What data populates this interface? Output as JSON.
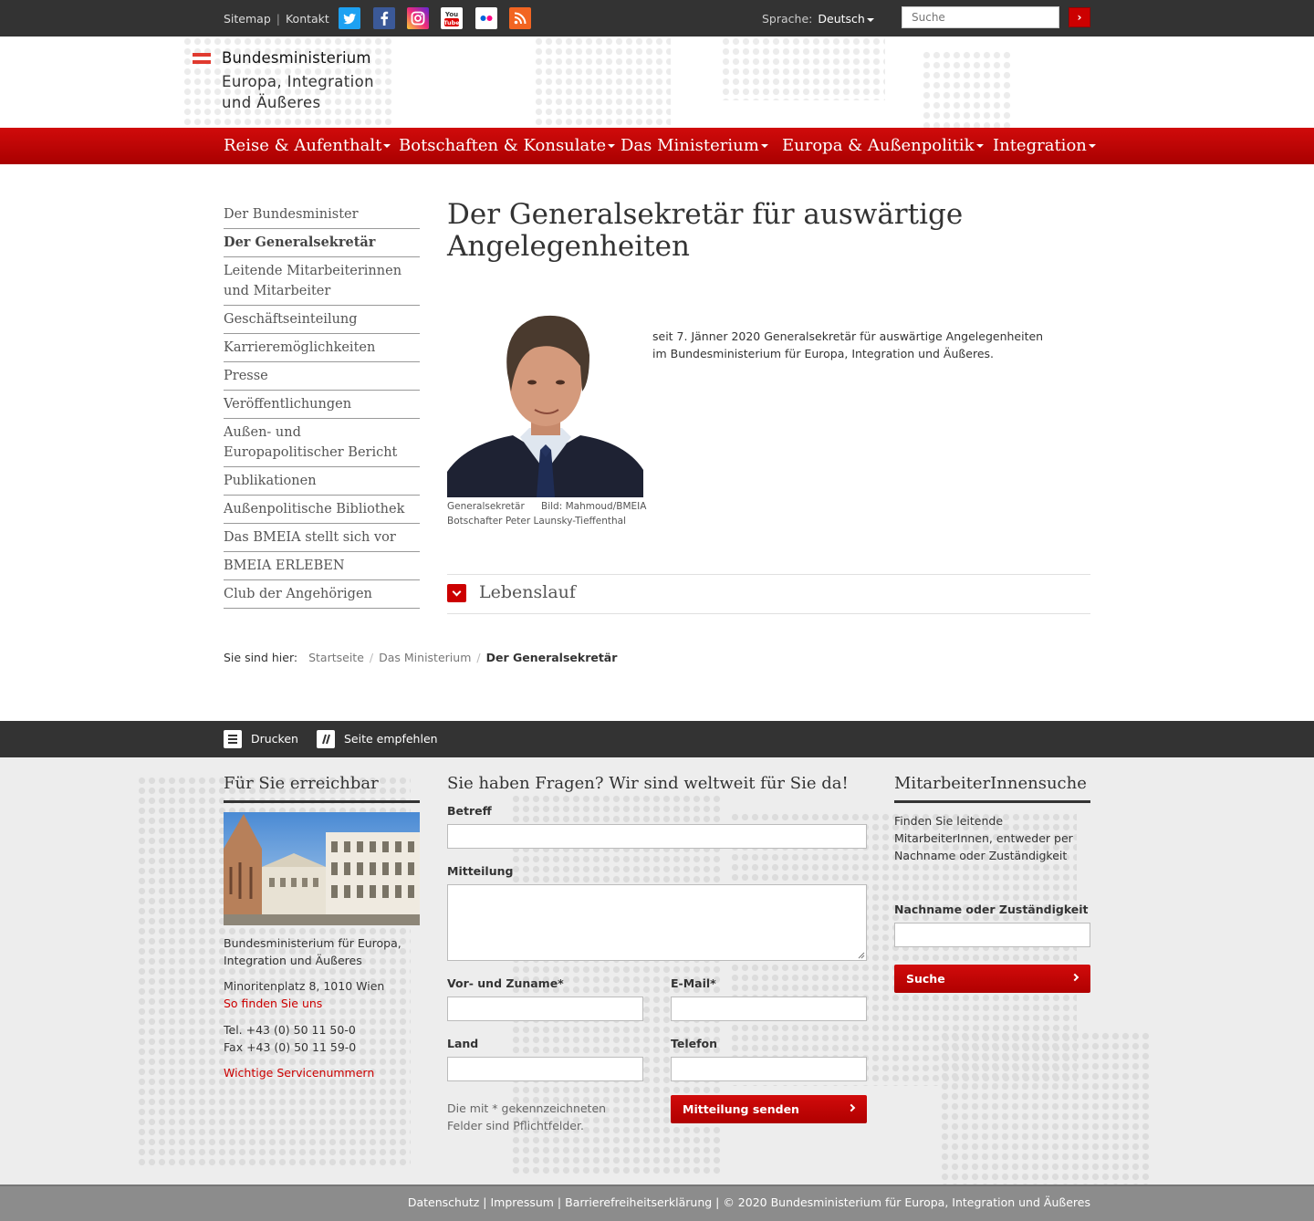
{
  "topbar": {
    "sitemap": "Sitemap",
    "separator": "|",
    "kontakt": "Kontakt",
    "social_icons": [
      "twitter-icon",
      "facebook-icon",
      "instagram-icon",
      "youtube-icon",
      "flickr-icon",
      "rss-icon"
    ],
    "language_label": "Sprache:",
    "language_value": "Deutsch",
    "search_placeholder": "Suche"
  },
  "header": {
    "logo_line1": "Bundesministerium",
    "logo_line2": "Europa, Integration",
    "logo_line3": "und Äußeres"
  },
  "mainnav": [
    "Reise & Aufenthalt",
    "Botschaften & Konsulate",
    "Das Ministerium",
    "Europa & Außenpolitik",
    "Integration"
  ],
  "subnav": [
    "Der Bundesminister",
    "Der Generalsekretär",
    "Leitende Mitarbeiterinnen und Mitarbeiter",
    "Geschäftseinteilung",
    "Karrieremöglichkeiten",
    "Presse",
    "Veröffentlichungen",
    "Außen- und Europapolitischer Bericht",
    "Publikationen",
    "Außenpolitische Bibliothek",
    "Das BMEIA stellt sich vor",
    "BMEIA ERLEBEN",
    "Club der Angehörigen"
  ],
  "content": {
    "title": "Der Generalsekretär für auswärtige Angelegenheiten",
    "caption_left": "Generalsekretär",
    "caption_right": "Bild: Mahmoud/BMEIA",
    "caption_line2": "Botschafter Peter Launsky-Tieffenthal",
    "intro": "seit 7. Jänner 2020 Generalsekretär für auswärtige Angelegenheiten im Bundesministerium für Europa, Integration und Äußeres.",
    "accordion": "Lebenslauf"
  },
  "breadcrumb": {
    "label": "Sie sind hier:",
    "items": [
      "Startseite",
      "Das Ministerium"
    ],
    "current": "Der Generalsekretär"
  },
  "toolbar": {
    "print": "Drucken",
    "recommend": "Seite empfehlen"
  },
  "footer": {
    "col1": {
      "heading": "Für Sie erreichbar",
      "org": "Bundesministerium für Europa, Integration und Äußeres",
      "address": "Minoritenplatz 8, 1010 Wien",
      "directions": "So finden Sie uns",
      "tel": "Tel. +43 (0) 50 11 50-0",
      "fax": "Fax +43 (0) 50 11 59-0",
      "service": "Wichtige Servicenummern"
    },
    "col2": {
      "heading": "Sie haben Fragen? Wir sind weltweit für Sie da!",
      "subject": "Betreff",
      "message": "Mitteilung",
      "name": "Vor- und Zuname*",
      "email": "E-Mail*",
      "country": "Land",
      "phone": "Telefon",
      "note": "Die mit * gekennzeichneten Felder sind Pflichtfelder.",
      "submit": "Mitteilung senden"
    },
    "col3": {
      "heading": "MitarbeiterInnensuche",
      "desc": "Finden Sie leitende MitarbeiterInnen, entweder per Nachname oder Zuständigkeit",
      "field_label": "Nachname oder Zuständigkeit",
      "button": "Suche"
    }
  },
  "bottombar": {
    "text": "Datenschutz | Impressum | Barrierefreiheitserklärung | © 2020 Bundesministerium für Europa, Integration und Äußeres"
  },
  "colors": {
    "brand_red": "#c00000",
    "dark_bar": "#333333",
    "footer_bg": "#ededed"
  }
}
